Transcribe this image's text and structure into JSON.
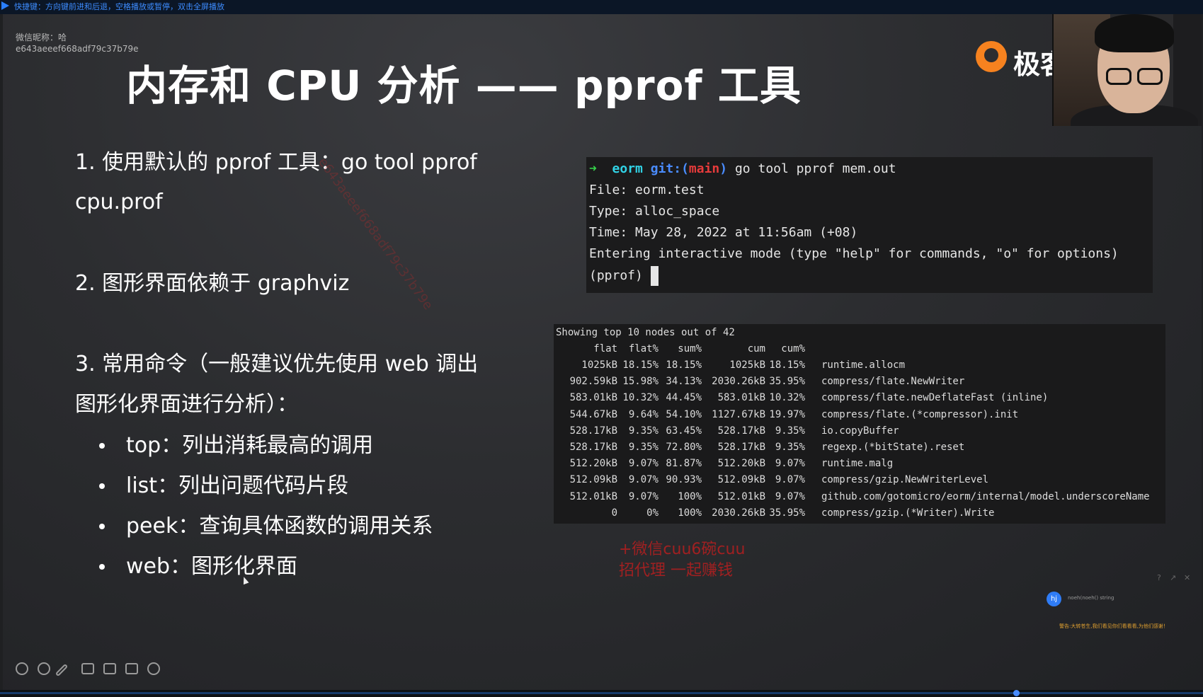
{
  "topbar": {
    "hint": "快捷键：方向键前进和后退，空格播放或暂停，双击全屏播放"
  },
  "wechat": {
    "label": "微信昵称：哈",
    "id": "e643aeeef668adf79c37b79e"
  },
  "slide": {
    "title": "内存和 CPU 分析 —— pprof 工具",
    "logo_text": "极客",
    "points": [
      {
        "line1": "1. 使用默认的 pprof 工具：go tool pprof",
        "line2": "cpu.prof"
      },
      {
        "line1": "2. 图形界面依赖于 graphviz"
      },
      {
        "line1": "3. 常用命令（一般建议优先使用 web 调出",
        "line2": "图形化界面进行分析）："
      }
    ],
    "subpoints": [
      "top：列出消耗最高的调用",
      "list：列出问题代码片段",
      "peek：查询具体函数的调用关系",
      "web：图形化界面"
    ]
  },
  "terminal1": {
    "arrow": "➜",
    "dir": "eorm",
    "git_prefix": "git:(",
    "branch": "main",
    "git_suffix": ")",
    "command": "go tool pprof mem.out",
    "lines": [
      "File: eorm.test",
      "Type: alloc_space",
      "Time: May 28, 2022 at 11:56am (+08)",
      "Entering interactive mode (type \"help\" for commands, \"o\" for options)"
    ],
    "prompt": "(pprof) "
  },
  "terminal2": {
    "header": "Showing top 10 nodes out of 42",
    "columns": [
      "flat",
      "flat%",
      "sum%",
      "cum",
      "cum%"
    ],
    "rows": [
      {
        "flat": "1025kB",
        "flatp": "18.15%",
        "sum": "18.15%",
        "cum": "1025kB",
        "cump": "18.15%",
        "fn": "runtime.allocm"
      },
      {
        "flat": "902.59kB",
        "flatp": "15.98%",
        "sum": "34.13%",
        "cum": "2030.26kB",
        "cump": "35.95%",
        "fn": "compress/flate.NewWriter"
      },
      {
        "flat": "583.01kB",
        "flatp": "10.32%",
        "sum": "44.45%",
        "cum": "583.01kB",
        "cump": "10.32%",
        "fn": "compress/flate.newDeflateFast (inline)"
      },
      {
        "flat": "544.67kB",
        "flatp": "9.64%",
        "sum": "54.10%",
        "cum": "1127.67kB",
        "cump": "19.97%",
        "fn": "compress/flate.(*compressor).init"
      },
      {
        "flat": "528.17kB",
        "flatp": "9.35%",
        "sum": "63.45%",
        "cum": "528.17kB",
        "cump": "9.35%",
        "fn": "io.copyBuffer"
      },
      {
        "flat": "528.17kB",
        "flatp": "9.35%",
        "sum": "72.80%",
        "cum": "528.17kB",
        "cump": "9.35%",
        "fn": "regexp.(*bitState).reset"
      },
      {
        "flat": "512.20kB",
        "flatp": "9.07%",
        "sum": "81.87%",
        "cum": "512.20kB",
        "cump": "9.07%",
        "fn": "runtime.malg"
      },
      {
        "flat": "512.09kB",
        "flatp": "9.07%",
        "sum": "90.93%",
        "cum": "512.09kB",
        "cump": "9.07%",
        "fn": "compress/gzip.NewWriterLevel"
      },
      {
        "flat": "512.01kB",
        "flatp": "9.07%",
        "sum": "100%",
        "cum": "512.01kB",
        "cump": "9.07%",
        "fn": "github.com/gotomicro/eorm/internal/model.underscoreName"
      },
      {
        "flat": "0",
        "flatp": "0%",
        "sum": "100%",
        "cum": "2030.26kB",
        "cump": "35.95%",
        "fn": "compress/gzip.(*Writer).Write"
      }
    ]
  },
  "overlay": {
    "watermark": "e643aeeef668adf79c37b79e",
    "red_line1": "+微信cuu6碗cuu",
    "red_line2": "招代理 一起赚钱"
  },
  "chat": {
    "help": "?",
    "expand": "↗",
    "close": "✕",
    "avatar": "hj",
    "message": "noeh(noeh() string",
    "note": "警告:大转苍生,我们看见你们看看看,为他们感谢！"
  }
}
